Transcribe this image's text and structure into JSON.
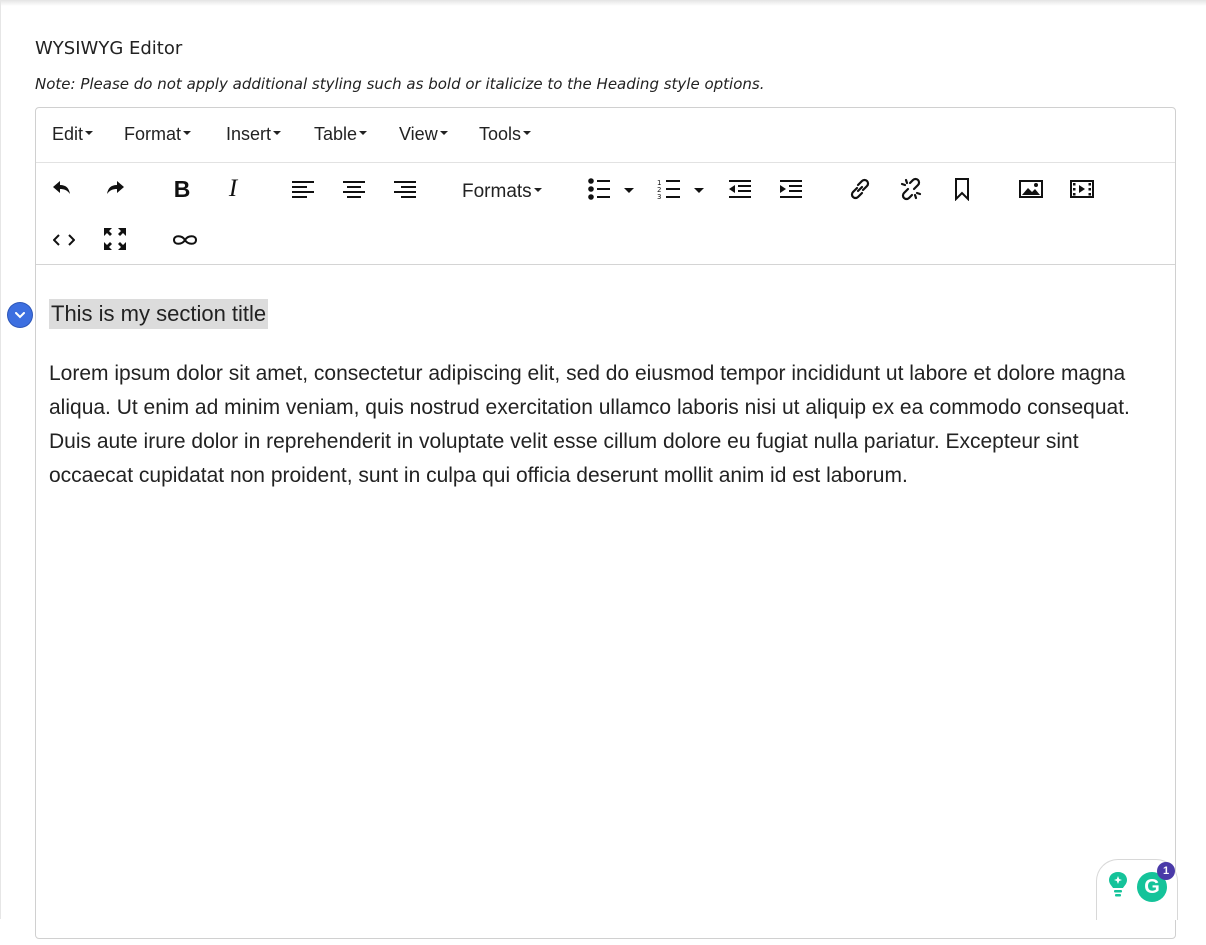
{
  "field": {
    "label": "WYSIWYG Editor",
    "note": "Note: Please do not apply additional styling such as bold or italicize to the Heading style options."
  },
  "menubar": {
    "items": [
      "Edit",
      "Format",
      "Insert",
      "Table",
      "View",
      "Tools"
    ]
  },
  "toolbar": {
    "row1": [
      "undo-icon",
      "redo-icon",
      "bold-icon",
      "italic-icon",
      "align-left-icon",
      "align-center-icon",
      "align-right-icon",
      "formats-dropdown",
      "bullet-list-icon",
      "numbered-list-icon",
      "outdent-icon",
      "indent-icon",
      "link-icon",
      "unlink-icon",
      "bookmark-icon",
      "image-icon",
      "video-icon"
    ],
    "row2": [
      "source-code-icon",
      "fullscreen-icon",
      "infinity-icon"
    ],
    "formats_label": "Formats"
  },
  "content": {
    "section_title": "This is my section title",
    "paragraph": "Lorem ipsum dolor sit amet, consectetur adipiscing elit, sed do eiusmod tempor incididunt ut labore et dolore magna aliqua. Ut enim ad minim veniam, quis nostrud exercitation ullamco laboris nisi ut aliquip ex ea commodo consequat. Duis aute irure dolor in reprehenderit in voluptate velit esse cillum dolore eu fugiat nulla pariatur. Excepteur sint occaecat cupidatat non proident, sunt in culpa qui officia deserunt mollit anim id est laborum."
  },
  "grammarly": {
    "badge_count": "1",
    "logo_letter": "G"
  },
  "colors": {
    "toggle": "#3d6fe0",
    "grammarly_green": "#15c39a",
    "badge": "#4a3aa8",
    "highlight": "#dcdcdc"
  }
}
